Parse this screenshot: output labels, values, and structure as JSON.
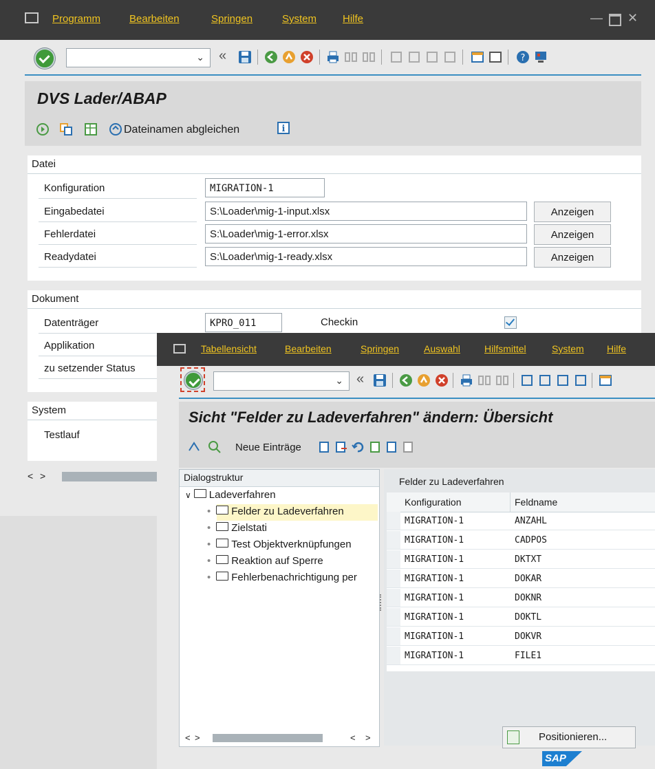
{
  "main_window": {
    "menu": [
      "Programm",
      "Bearbeiten",
      "Springen",
      "System",
      "Hilfe"
    ],
    "title": "DVS Lader/ABAP",
    "app_toolbar": {
      "sync_label": "Dateinamen abgleichen"
    },
    "datei": {
      "header": "Datei",
      "rows": [
        {
          "label": "Konfiguration",
          "value": "MIGRATION-1"
        },
        {
          "label": "Eingabedatei",
          "value": "S:\\Loader\\mig-1-input.xlsx",
          "button": "Anzeigen"
        },
        {
          "label": "Fehlerdatei",
          "value": "S:\\Loader\\mig-1-error.xlsx",
          "button": "Anzeigen"
        },
        {
          "label": "Readydatei",
          "value": "S:\\Loader\\mig-1-ready.xlsx",
          "button": "Anzeigen"
        }
      ]
    },
    "dokument": {
      "header": "Dokument",
      "datentraeger_label": "Datenträger",
      "datentraeger_value": "KPRO_011",
      "checkin_label": "Checkin",
      "checkin_checked": true,
      "applikation_label": "Applikation",
      "status_label": "zu setzender Status"
    },
    "system": {
      "header": "System",
      "testlauf_label": "Testlauf"
    }
  },
  "second_window": {
    "menu": [
      "Tabellensicht",
      "Bearbeiten",
      "Springen",
      "Auswahl",
      "Hilfsmittel",
      "System",
      "Hilfe"
    ],
    "title": "Sicht \"Felder zu Ladeverfahren\" ändern: Übersicht",
    "app_toolbar": {
      "new_entries_label": "Neue Einträge"
    },
    "tree": {
      "header": "Dialogstruktur",
      "root": "Ladeverfahren",
      "children": [
        "Felder zu Ladeverfahren",
        "Zielstati",
        "Test Objektverknüpfungen",
        "Reaktion auf Sperre",
        "Fehlerbenachrichtigung per"
      ]
    },
    "table": {
      "header": "Felder zu Ladeverfahren",
      "columns": [
        "Konfiguration",
        "Feldname"
      ],
      "rows": [
        [
          "MIGRATION-1",
          "ANZAHL"
        ],
        [
          "MIGRATION-1",
          "CADPOS"
        ],
        [
          "MIGRATION-1",
          "DKTXT"
        ],
        [
          "MIGRATION-1",
          "DOKAR"
        ],
        [
          "MIGRATION-1",
          "DOKNR"
        ],
        [
          "MIGRATION-1",
          "DOKTL"
        ],
        [
          "MIGRATION-1",
          "DOKVR"
        ],
        [
          "MIGRATION-1",
          "FILE1"
        ]
      ]
    },
    "position_button": "Positionieren...",
    "brand": "SAP"
  },
  "colors": {
    "menubar": "#3a3a3a",
    "menu_text": "#f0c420",
    "accent_line": "#3a8ec2",
    "brand_blue": "#1d7fd0"
  }
}
